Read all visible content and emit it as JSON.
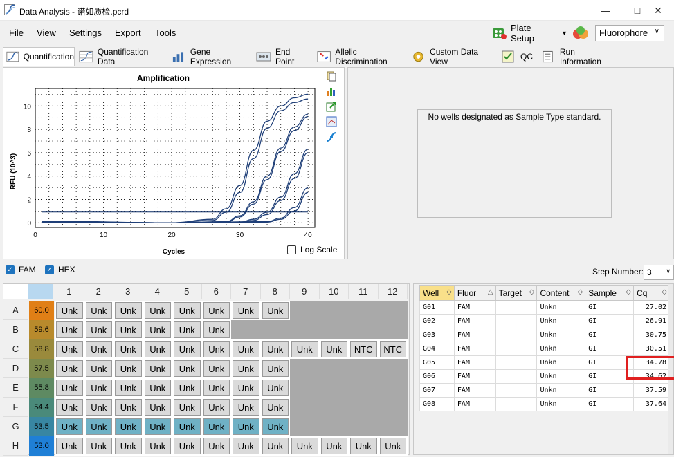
{
  "window": {
    "title": "Data Analysis - 诺如质检.pcrd"
  },
  "menu": {
    "items": [
      "File",
      "View",
      "Settings",
      "Export",
      "Tools"
    ]
  },
  "toolbar": {
    "plate_setup": "Plate Setup",
    "fluorophore_select": "Fluorophore"
  },
  "tabs": [
    "Quantification",
    "Quantification Data",
    "Gene Expression",
    "End Point",
    "Allelic Discrimination",
    "Custom Data View",
    "QC",
    "Run Information"
  ],
  "chart": {
    "title": "Amplification",
    "log_scale_label": "Log Scale"
  },
  "chart_data": {
    "type": "line",
    "title": "Amplification",
    "xlabel": "Cycles",
    "ylabel": "RFU (10^3)",
    "xlim": [
      0,
      41
    ],
    "ylim": [
      -0.4,
      11.5
    ],
    "xticks": [
      0,
      10,
      20,
      30,
      40
    ],
    "yticks": [
      0,
      2,
      4,
      6,
      8,
      10
    ],
    "threshold": 0.95,
    "series": [
      {
        "x": [
          1,
          20,
          26,
          28,
          30,
          32,
          34,
          36,
          38,
          40
        ],
        "values": [
          0.05,
          0.0,
          0.3,
          1.2,
          3.2,
          6.2,
          8.7,
          10.0,
          10.7,
          11.0
        ]
      },
      {
        "x": [
          1,
          20,
          26,
          28,
          30,
          32,
          34,
          36,
          38,
          40
        ],
        "values": [
          0.05,
          0.0,
          0.2,
          0.9,
          2.6,
          5.5,
          8.1,
          9.6,
          10.3,
          10.6
        ]
      },
      {
        "x": [
          1,
          20,
          28,
          30,
          32,
          34,
          36,
          38,
          40
        ],
        "values": [
          0.15,
          0.0,
          0.1,
          0.6,
          1.8,
          4.0,
          6.4,
          8.2,
          9.3
        ]
      },
      {
        "x": [
          1,
          20,
          28,
          30,
          32,
          34,
          36,
          38,
          40
        ],
        "values": [
          0.1,
          0.0,
          0.05,
          0.5,
          1.6,
          3.7,
          6.1,
          7.9,
          9.1
        ]
      },
      {
        "x": [
          1,
          20,
          30,
          32,
          34,
          36,
          38,
          40
        ],
        "values": [
          0.1,
          0.0,
          0.05,
          0.3,
          0.9,
          2.2,
          4.2,
          6.3
        ]
      },
      {
        "x": [
          1,
          20,
          30,
          32,
          34,
          36,
          38,
          40
        ],
        "values": [
          0.1,
          0.0,
          0.05,
          0.2,
          0.7,
          1.9,
          3.8,
          6.0
        ]
      },
      {
        "x": [
          1,
          20,
          34,
          36,
          38,
          40
        ],
        "values": [
          0.05,
          0.0,
          0.1,
          0.4,
          1.3,
          3.0
        ]
      },
      {
        "x": [
          1,
          20,
          34,
          36,
          38,
          40
        ],
        "values": [
          0.05,
          0.0,
          0.05,
          0.3,
          1.0,
          2.6
        ]
      }
    ]
  },
  "right_panel": {
    "message": "No wells designated as Sample Type standard."
  },
  "channels": [
    {
      "label": "FAM",
      "checked": true
    },
    {
      "label": "HEX",
      "checked": true
    }
  ],
  "step": {
    "label": "Step Number:",
    "value": "3"
  },
  "plate": {
    "columns": [
      "1",
      "2",
      "3",
      "4",
      "5",
      "6",
      "7",
      "8",
      "9",
      "10",
      "11",
      "12"
    ],
    "rows": [
      {
        "label": "A",
        "temp": "60.0",
        "color": "#e07f16",
        "wells": [
          "Unk",
          "Unk",
          "Unk",
          "Unk",
          "Unk",
          "Unk",
          "Unk",
          "Unk",
          "",
          "",
          "",
          ""
        ]
      },
      {
        "label": "B",
        "temp": "59.6",
        "color": "#b88a2c",
        "wells": [
          "Unk",
          "Unk",
          "Unk",
          "Unk",
          "Unk",
          "Unk",
          "",
          "",
          "",
          "",
          "",
          ""
        ]
      },
      {
        "label": "C",
        "temp": "58.8",
        "color": "#9a8a3c",
        "wells": [
          "Unk",
          "Unk",
          "Unk",
          "Unk",
          "Unk",
          "Unk",
          "Unk",
          "Unk",
          "Unk",
          "Unk",
          "NTC",
          "NTC"
        ]
      },
      {
        "label": "D",
        "temp": "57.5",
        "color": "#7d8a4c",
        "wells": [
          "Unk",
          "Unk",
          "Unk",
          "Unk",
          "Unk",
          "Unk",
          "Unk",
          "Unk",
          "",
          "",
          "",
          ""
        ]
      },
      {
        "label": "E",
        "temp": "55.8",
        "color": "#5e8a62",
        "wells": [
          "Unk",
          "Unk",
          "Unk",
          "Unk",
          "Unk",
          "Unk",
          "Unk",
          "Unk",
          "",
          "",
          "",
          ""
        ]
      },
      {
        "label": "F",
        "temp": "54.4",
        "color": "#4a8a7a",
        "wells": [
          "Unk",
          "Unk",
          "Unk",
          "Unk",
          "Unk",
          "Unk",
          "Unk",
          "Unk",
          "",
          "",
          "",
          ""
        ]
      },
      {
        "label": "G",
        "temp": "53.5",
        "color": "#3886a2",
        "wells": [
          "Unk",
          "Unk",
          "Unk",
          "Unk",
          "Unk",
          "Unk",
          "Unk",
          "Unk",
          "",
          "",
          "",
          ""
        ],
        "selected": true
      },
      {
        "label": "H",
        "temp": "53.0",
        "color": "#1f7fd6",
        "wells": [
          "Unk",
          "Unk",
          "Unk",
          "Unk",
          "Unk",
          "Unk",
          "Unk",
          "Unk",
          "Unk",
          "Unk",
          "Unk",
          "Unk"
        ]
      }
    ]
  },
  "results": {
    "headers": [
      "Well",
      "Fluor",
      "Target",
      "Content",
      "Sample",
      "Cq"
    ],
    "rows": [
      [
        "G01",
        "FAM",
        "",
        "Unkn",
        "GI",
        "27.02"
      ],
      [
        "G02",
        "FAM",
        "",
        "Unkn",
        "GI",
        "26.91"
      ],
      [
        "G03",
        "FAM",
        "",
        "Unkn",
        "GI",
        "30.75"
      ],
      [
        "G04",
        "FAM",
        "",
        "Unkn",
        "GI",
        "30.51"
      ],
      [
        "G05",
        "FAM",
        "",
        "Unkn",
        "GI",
        "34.78"
      ],
      [
        "G06",
        "FAM",
        "",
        "Unkn",
        "GI",
        "34.62"
      ],
      [
        "G07",
        "FAM",
        "",
        "Unkn",
        "GI",
        "37.59"
      ],
      [
        "G08",
        "FAM",
        "",
        "Unkn",
        "GI",
        "37.64"
      ]
    ]
  }
}
